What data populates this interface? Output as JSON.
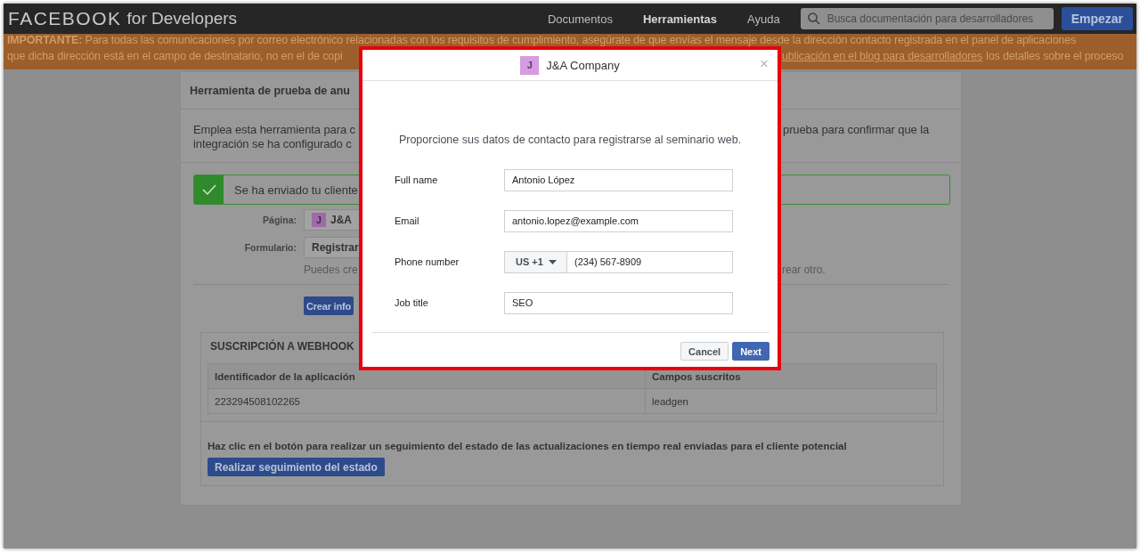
{
  "header": {
    "logo": "FACEBOOK",
    "logo_suffix": "for Developers",
    "nav": [
      {
        "label": "Documentos",
        "selected": false
      },
      {
        "label": "Herramientas",
        "selected": true
      },
      {
        "label": "Ayuda",
        "selected": false
      }
    ],
    "search": {
      "placeholder": "Busca documentación para desarrolladores"
    },
    "cta": "Empezar"
  },
  "banner": {
    "line_1": "**IMPORTANTE:** Para todas las comunicaciones por correo electrónico relacionadas con los requisitos de cumplimiento, asegúrate de que envías el mensaje desde la dirección contacto registrada en el panel de aplicaciones",
    "line_2_left": "que dicha dirección está en el campo de destinatario, no en el de copi",
    "line_2_link": "ublicación en el blog para desarrolladores",
    "line_2_right": "los detalles sobre el proceso"
  },
  "tool_card": {
    "title": "Herramienta de prueba de anu",
    "description_left": [
      "Emplea esta herramienta para c",
      "integración se ha configurado c"
    ],
    "description_right": "prueba para confirmar que la",
    "success_message": "Se ha enviado tu cliente",
    "page_label": "Página:",
    "page_avatar": "J",
    "page_value": "J&A",
    "form_label": "Formulario:",
    "form_value": "Registrar",
    "hint_left": "Puedes cre",
    "hint_right": "rear otro.",
    "create_button": "Crear info",
    "webhook": {
      "title": "SUSCRIPCIÓN A WEBHOOK",
      "columns": [
        "Identificador de la aplicación",
        "Campos suscritos"
      ],
      "rows": [
        [
          "223294508102265",
          "leadgen"
        ]
      ],
      "instruction": "Haz clic en el botón para realizar un seguimiento del estado de las actualizaciones en tiempo real enviadas para el cliente potencial",
      "track_button": "Realizar seguimiento del estado"
    }
  },
  "modal": {
    "avatar": "J",
    "title": "J&A Company",
    "close": "×",
    "prompt": "Proporcione sus datos de contacto para registrarse al seminario web.",
    "fields": [
      {
        "kind": "text",
        "label": "Full name",
        "value": "Antonio López"
      },
      {
        "kind": "text",
        "label": "Email",
        "value": "antonio.lopez@example.com"
      },
      {
        "kind": "phone",
        "label": "Phone number",
        "country": "US +1",
        "value": "(234) 567-8909"
      },
      {
        "kind": "text",
        "label": "Job title",
        "value": "SEO"
      }
    ],
    "buttons": [
      {
        "kind": "secondary",
        "label": "Cancel"
      },
      {
        "kind": "primary",
        "label": "Next"
      }
    ]
  }
}
